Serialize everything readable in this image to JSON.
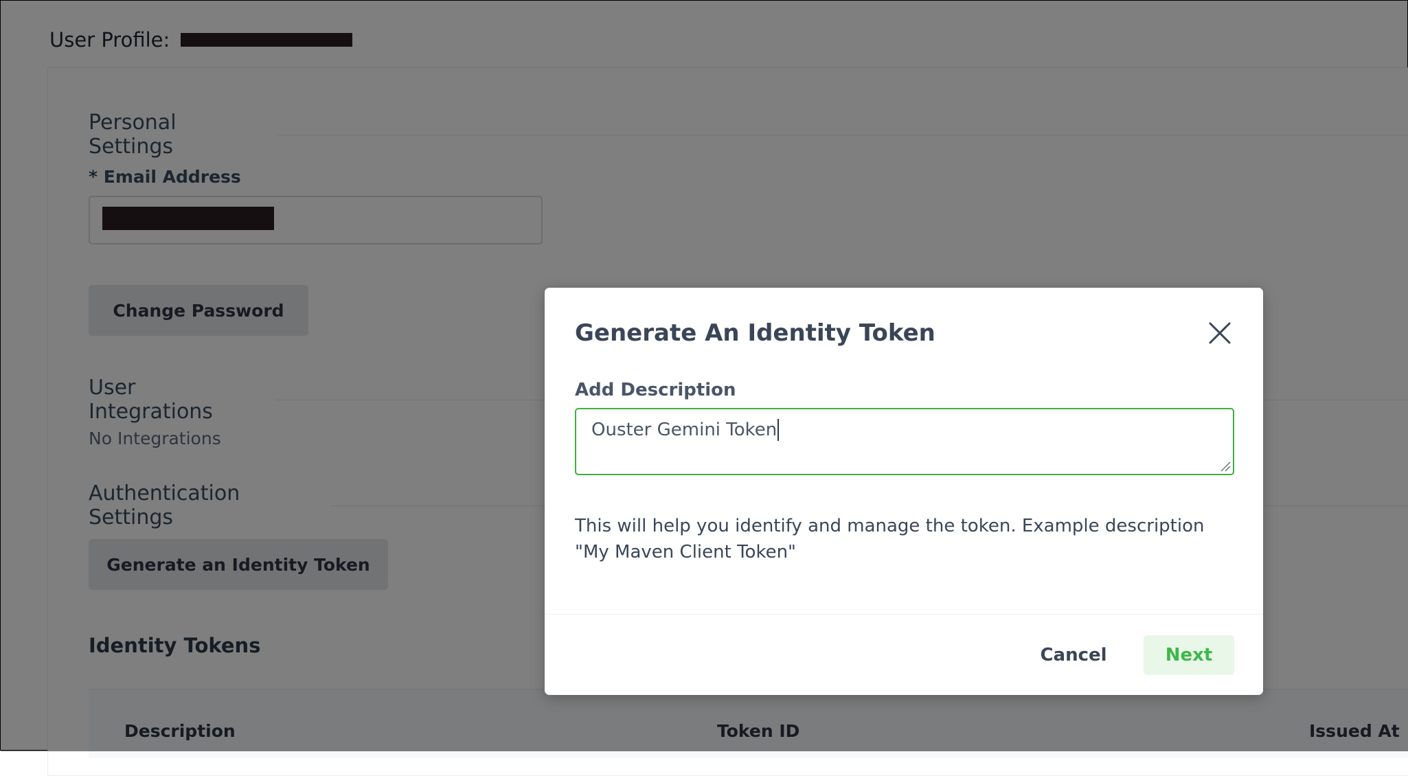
{
  "profile": {
    "header_label": "User Profile:",
    "username_redacted": ""
  },
  "personal_settings": {
    "title": "Personal Settings",
    "email_label": "* Email Address",
    "email_value_redacted": "",
    "change_password_label": "Change Password"
  },
  "integrations": {
    "title": "User Integrations",
    "empty_text": "No Integrations"
  },
  "auth_settings": {
    "title": "Authentication Settings",
    "generate_button_label": "Generate an Identity Token"
  },
  "identity_tokens": {
    "title": "Identity Tokens",
    "columns": [
      "Description",
      "Token ID",
      "Issued At"
    ]
  },
  "modal": {
    "title": "Generate An Identity Token",
    "description_label": "Add Description",
    "description_value": "Ouster Gemini Token",
    "help_text": "This will help you identify and manage the token. Example description \"My Maven Client Token\"",
    "cancel_label": "Cancel",
    "next_label": "Next"
  },
  "colors": {
    "accent_green": "#3fb84a",
    "overlay": "rgba(0,0,0,0.5)",
    "redaction": "#2a1f22"
  },
  "icons": {
    "close": "close-icon",
    "resize": "resize-handle-icon"
  }
}
